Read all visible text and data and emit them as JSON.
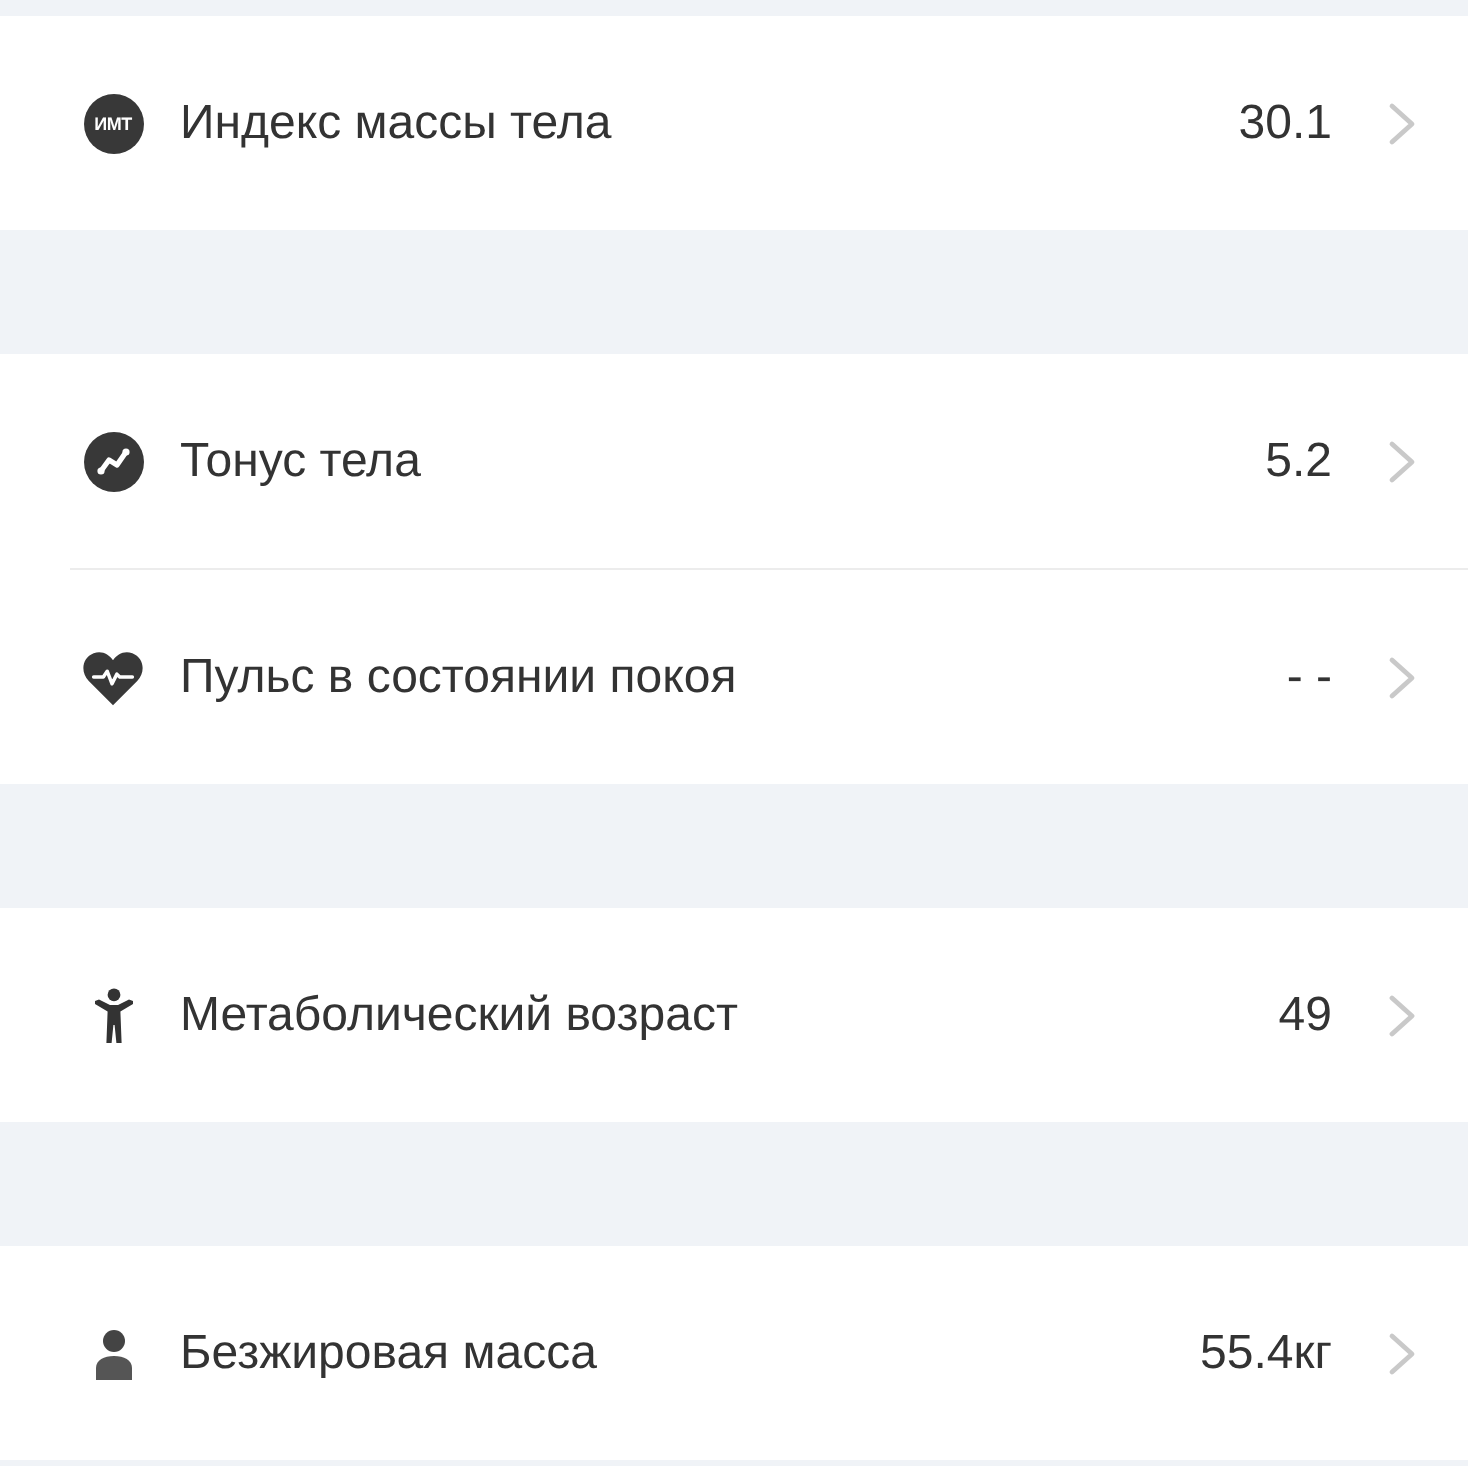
{
  "sections": [
    {
      "rows": [
        {
          "badge": "ИМТ",
          "label": "Индекс массы тела",
          "value": "30.1"
        }
      ]
    },
    {
      "rows": [
        {
          "label": "Тонус тела",
          "value": "5.2"
        },
        {
          "label": "Пульс в состоянии покоя",
          "value": "- -"
        }
      ]
    },
    {
      "rows": [
        {
          "label": "Метаболический возраст",
          "value": "49"
        }
      ]
    },
    {
      "rows": [
        {
          "label": "Безжировая масса",
          "value": "55.4кг"
        }
      ]
    }
  ]
}
